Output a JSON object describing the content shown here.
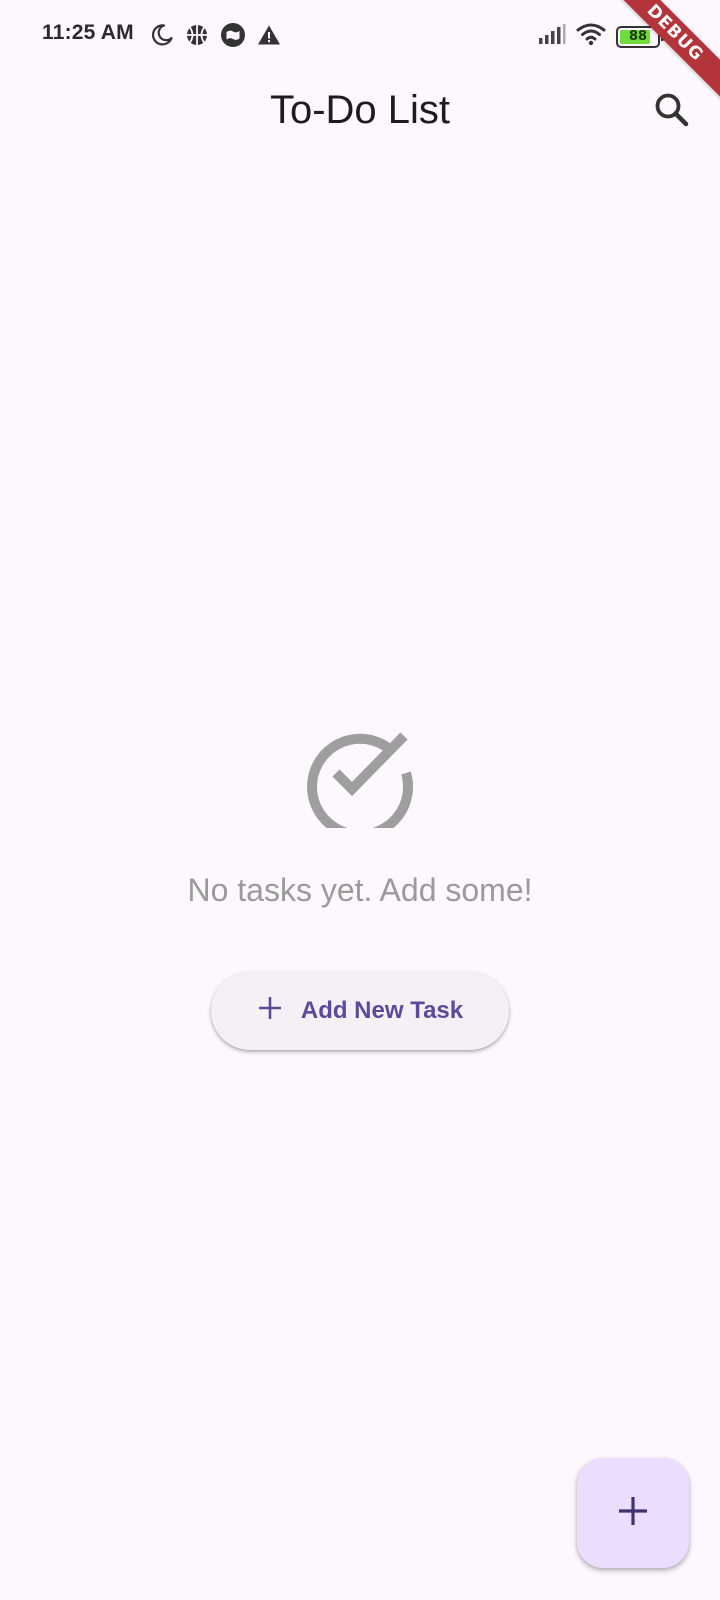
{
  "status_bar": {
    "time": "11:25 AM",
    "battery_level": "88",
    "left_icons": [
      "moon-icon",
      "basketball-icon",
      "message-icon",
      "warning-icon"
    ],
    "right_icons": [
      "signal-icon",
      "wifi-icon",
      "battery-icon",
      "charging-icon"
    ]
  },
  "debug_banner": {
    "label": "DEBUG"
  },
  "app_bar": {
    "title": "To-Do List",
    "search_icon": "search-icon"
  },
  "empty_state": {
    "icon": "check-circle-icon",
    "message": "No tasks yet. Add some!",
    "button_label": "Add New Task",
    "button_icon": "plus-icon"
  },
  "fab": {
    "icon": "plus-icon"
  },
  "colors": {
    "background": "#fdf7fe",
    "primary": "#5d4a9a",
    "fab_background": "#eaddfd",
    "muted_text": "#9a9a9a",
    "debug_banner": "#b3343a",
    "battery_fill": "#6fdc3c"
  }
}
